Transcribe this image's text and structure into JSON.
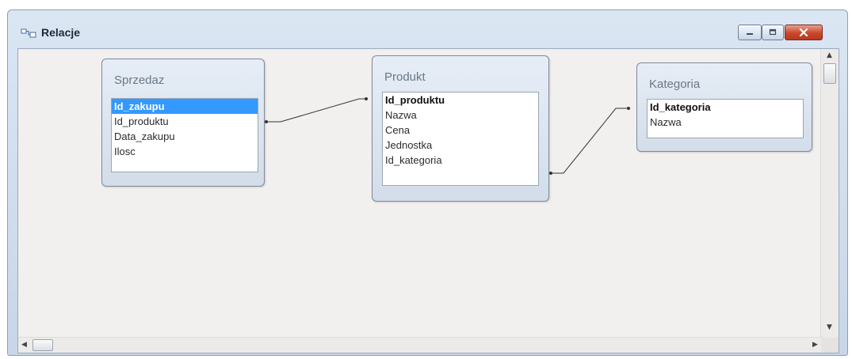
{
  "window": {
    "title": "Relacje"
  },
  "tables": [
    {
      "name": "Sprzedaz",
      "fields": [
        "Id_zakupu",
        "Id_produktu",
        "Data_zakupu",
        "Ilosc"
      ]
    },
    {
      "name": "Produkt",
      "fields": [
        "Id_produktu",
        "Nazwa",
        "Cena",
        "Jednostka",
        "Id_kategoria"
      ]
    },
    {
      "name": "Kategoria",
      "fields": [
        "Id_kategoria",
        "Nazwa"
      ]
    }
  ],
  "icons": [
    "relationships-icon",
    "minimize-icon",
    "maximize-icon",
    "close-icon",
    "scroll-up-icon",
    "scroll-down-icon",
    "scroll-left-icon",
    "scroll-right-icon"
  ],
  "colors": {
    "selection": "#3399ff",
    "close_button": "#c9472c",
    "relationship_line": "#333333"
  }
}
